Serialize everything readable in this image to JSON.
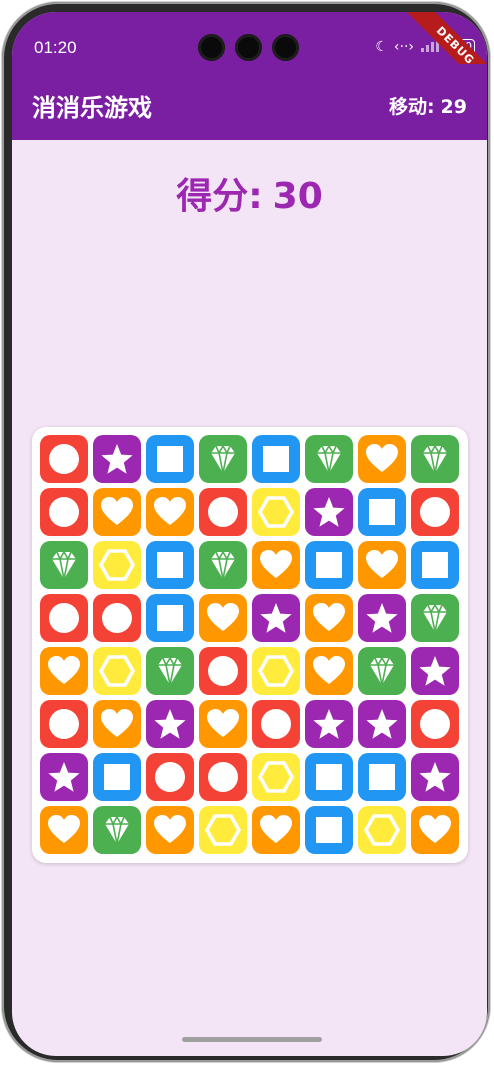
{
  "status_bar": {
    "time": "01:20",
    "battery": "100"
  },
  "debug_banner": "DEBUG",
  "app_bar": {
    "title": "消消乐游戏",
    "moves_label": "移动:",
    "moves_value": "29"
  },
  "score": {
    "label": "得分:",
    "value": "30"
  },
  "colors": {
    "primary": "#7b1fa2",
    "background": "#f3e5f5",
    "score_text": "#9c27b0"
  },
  "tile_types": {
    "circle": {
      "color": "#f44336",
      "icon": "circle-icon"
    },
    "star": {
      "color": "#9c27b0",
      "icon": "star-icon"
    },
    "square": {
      "color": "#2196f3",
      "icon": "square-icon"
    },
    "diamond": {
      "color": "#4caf50",
      "icon": "diamond-icon"
    },
    "heart": {
      "color": "#ff9800",
      "icon": "heart-icon"
    },
    "hexagon": {
      "color": "#ffeb3b",
      "icon": "hexagon-icon"
    }
  },
  "board": [
    [
      "circle",
      "star",
      "square",
      "diamond",
      "square",
      "diamond",
      "heart",
      "diamond"
    ],
    [
      "circle",
      "heart",
      "heart",
      "circle",
      "hexagon",
      "star",
      "square",
      "circle"
    ],
    [
      "diamond",
      "hexagon",
      "square",
      "diamond",
      "heart",
      "square",
      "heart",
      "square"
    ],
    [
      "circle",
      "circle",
      "square",
      "heart",
      "star",
      "heart",
      "star",
      "diamond"
    ],
    [
      "heart",
      "hexagon",
      "diamond",
      "circle",
      "hexagon",
      "heart",
      "diamond",
      "star"
    ],
    [
      "circle",
      "heart",
      "star",
      "heart",
      "circle",
      "star",
      "star",
      "circle"
    ],
    [
      "star",
      "square",
      "circle",
      "circle",
      "hexagon",
      "square",
      "square",
      "star"
    ],
    [
      "heart",
      "diamond",
      "heart",
      "hexagon",
      "heart",
      "square",
      "hexagon",
      "heart"
    ]
  ]
}
